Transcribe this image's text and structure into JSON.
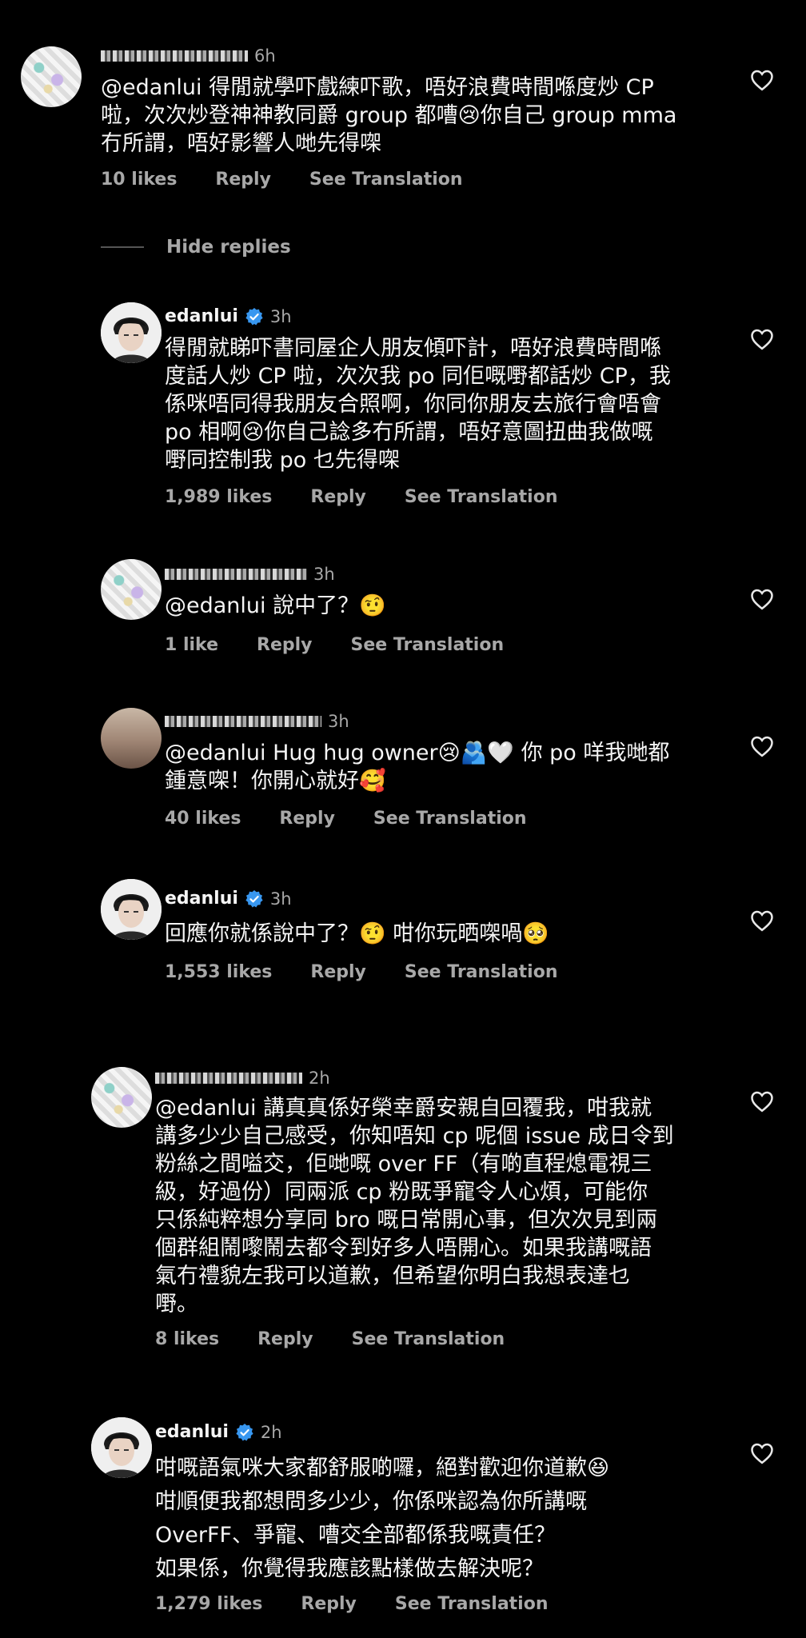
{
  "comments": [
    {
      "id": "c1",
      "username": "belle_in_castle",
      "username_blurred": true,
      "time": "6h",
      "verified": false,
      "lines": [
        "@edanlui 得閒就學吓戲練吓歌，唔好浪費時間喺度炒 CP",
        "啦，次次炒登神神教同爵 group 都嘈😢你自己 group mma",
        "冇所謂，唔好影響人哋先得㗎"
      ],
      "likes": "10 likes",
      "reply": "Reply",
      "translate": "See Translation"
    },
    {
      "id": "c2",
      "username": "edanlui",
      "username_blurred": false,
      "time": "3h",
      "verified": true,
      "lines": [
        "得閒就睇吓書同屋企人朋友傾吓計，唔好浪費時間喺",
        "度話人炒 CP 啦，次次我 po 同佢嘅嘢都話炒 CP，我",
        "係咪唔同得我朋友合照啊，你同你朋友去旅行會唔會",
        "po 相啊😢你自己諗多冇所謂，唔好意圖扭曲我做嘅",
        "嘢同控制我 po 乜先得㗎"
      ],
      "likes": "1,989 likes",
      "reply": "Reply",
      "translate": "See Translation"
    },
    {
      "id": "c3",
      "username": "belle_in_castle",
      "username_blurred": true,
      "time": "3h",
      "verified": false,
      "lines": [
        "@edanlui 說中了？🤨"
      ],
      "likes": "1 like",
      "reply": "Reply",
      "translate": "See Translation"
    },
    {
      "id": "c4",
      "username": "commence_swallow",
      "username_blurred": true,
      "time": "3h",
      "verified": false,
      "lines": [
        "@edanlui Hug hug owner😢🫂🤍 你 po 咩我哋都",
        "鍾意㗎！你開心就好🥰"
      ],
      "likes": "40 likes",
      "reply": "Reply",
      "translate": "See Translation"
    },
    {
      "id": "c5",
      "username": "edanlui",
      "username_blurred": false,
      "time": "3h",
      "verified": true,
      "lines": [
        "回應你就係說中了？🤨 咁你玩晒㗎喎🥺"
      ],
      "likes": "1,553 likes",
      "reply": "Reply",
      "translate": "See Translation"
    },
    {
      "id": "c6",
      "username": "belle_in_castle",
      "username_blurred": true,
      "time": "2h",
      "verified": false,
      "lines": [
        "@edanlui 講真真係好榮幸爵安親自回覆我，咁我就",
        "講多少少自己感受，你知唔知 cp 呢個 issue 成日令到",
        "粉絲之間嗌交，佢哋嘅 over FF（有啲直程熄電視三",
        "級，好過份）同兩派 cp 粉既爭寵令人心煩，可能你",
        "只係純粹想分享同 bro 嘅日常開心事，但次次見到兩",
        "個群組鬧嚟鬧去都令到好多人唔開心。如果我講嘅語",
        "氣冇禮貌左我可以道歉，但希望你明白我想表達乜",
        "嘢。"
      ],
      "likes": "8 likes",
      "reply": "Reply",
      "translate": "See Translation"
    },
    {
      "id": "c7",
      "username": "edanlui",
      "username_blurred": false,
      "time": "2h",
      "verified": true,
      "lines": [
        "咁嘅語氣咪大家都舒服啲囉，絕對歡迎你道歉😆",
        "咁順便我都想問多少少，你係咪認為你所講嘅",
        "OverFF、爭寵、嘈交全部都係我嘅責任？",
        "如果係，你覺得我應該點樣做去解決呢？"
      ],
      "likes": "1,279 likes",
      "reply": "Reply",
      "translate": "See Translation"
    }
  ],
  "hide_replies": "Hide replies",
  "colors": {
    "background": "#000000",
    "text": "#f5f5f5",
    "muted": "#a8a8a8",
    "verified": "#3897f0"
  },
  "icons": {
    "like": "heart-outline-icon",
    "verified": "verified-badge-icon"
  }
}
